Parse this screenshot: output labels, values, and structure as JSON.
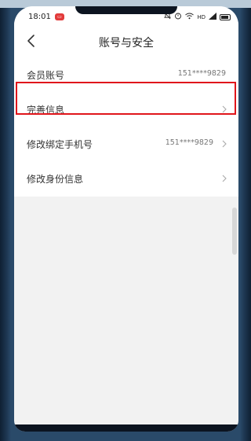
{
  "status_bar": {
    "time": "18:01",
    "app_badge": "▭",
    "icons": [
      "bell-off-icon",
      "alarm-icon",
      "wifi-icon",
      "hd-icon",
      "signal-icon",
      "battery-icon"
    ],
    "hd_label": "HD"
  },
  "header": {
    "title": "账号与安全",
    "back_icon": "chevron-left-icon"
  },
  "list": {
    "member_account": {
      "label": "会员账号",
      "value": "151****9829"
    },
    "complete_info": {
      "label": "完善信息"
    },
    "bind_phone": {
      "label": "修改绑定手机号",
      "value": "151****9829"
    },
    "identity_info": {
      "label": "修改身份信息"
    }
  },
  "colors": {
    "highlight_border": "#e0151b",
    "background": "#f2f2f2",
    "row_background": "#ffffff"
  }
}
